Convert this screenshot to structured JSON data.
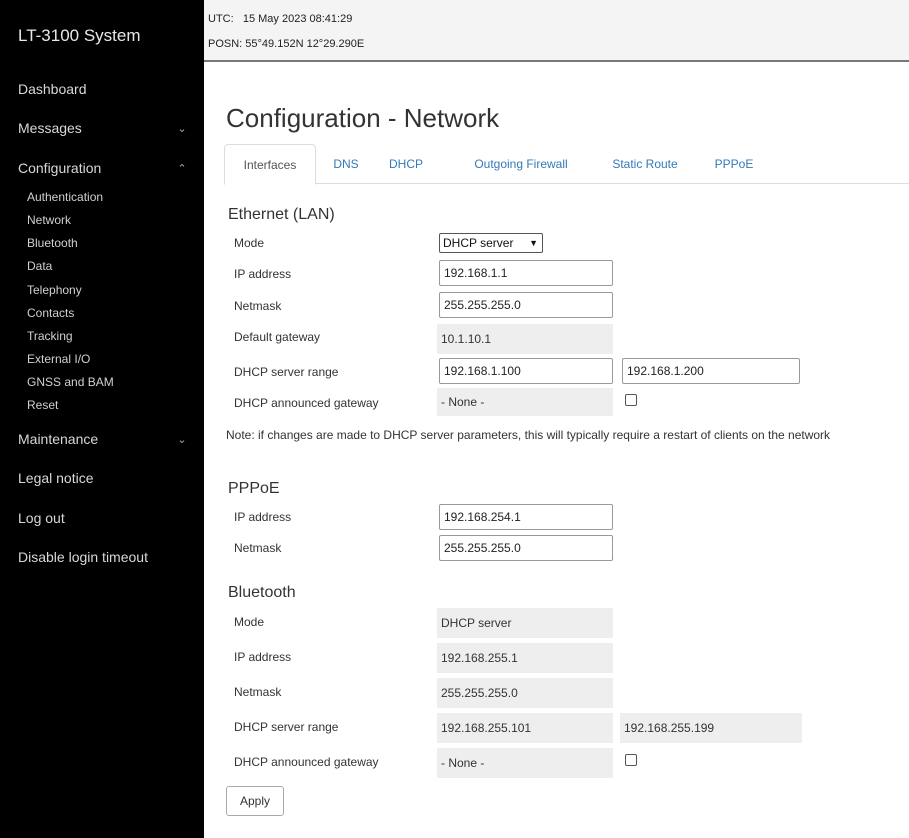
{
  "sidebar": {
    "brand": "LT-3100 System",
    "nav": [
      {
        "label": "Dashboard",
        "chevron": ""
      },
      {
        "label": "Messages",
        "chevron": "⌄"
      },
      {
        "label": "Configuration",
        "chevron": "⌃"
      },
      {
        "label": "Maintenance",
        "chevron": "⌄"
      },
      {
        "label": "Legal notice",
        "chevron": ""
      },
      {
        "label": "Log out",
        "chevron": ""
      },
      {
        "label": "Disable login timeout",
        "chevron": ""
      }
    ],
    "config_items": [
      "Authentication",
      "Network",
      "Bluetooth",
      "Data",
      "Telephony",
      "Contacts",
      "Tracking",
      "External I/O",
      "GNSS and BAM",
      "Reset"
    ]
  },
  "status": {
    "utc_label": "UTC:",
    "utc_value": "15 May 2023 08:41:29",
    "posn_label": "POSN:",
    "posn_value": "55°49.152N 12°29.290E"
  },
  "page_title": "Configuration - Network",
  "tabs": [
    "Interfaces",
    "DNS",
    "DHCP",
    "Outgoing Firewall",
    "Static Route",
    "PPPoE"
  ],
  "ethernet": {
    "title": "Ethernet (LAN)",
    "mode_label": "Mode",
    "mode_value": "DHCP server",
    "ip_label": "IP address",
    "ip_value": "192.168.1.1",
    "netmask_label": "Netmask",
    "netmask_value": "255.255.255.0",
    "gateway_label": "Default gateway",
    "gateway_value": "10.1.10.1",
    "range_label": "DHCP server range",
    "range_start": "192.168.1.100",
    "range_end": "192.168.1.200",
    "announced_label": "DHCP announced gateway",
    "announced_value": "- None -",
    "announced_checked": false
  },
  "note": "Note: if changes are made to DHCP server parameters, this will typically require a restart of clients on the network",
  "pppoe": {
    "title": "PPPoE",
    "ip_label": "IP address",
    "ip_value": "192.168.254.1",
    "netmask_label": "Netmask",
    "netmask_value": "255.255.255.0"
  },
  "bluetooth": {
    "title": "Bluetooth",
    "mode_label": "Mode",
    "mode_value": "DHCP server",
    "ip_label": "IP address",
    "ip_value": "192.168.255.1",
    "netmask_label": "Netmask",
    "netmask_value": "255.255.255.0",
    "range_label": "DHCP server range",
    "range_start": "192.168.255.101",
    "range_end": "192.168.255.199",
    "announced_label": "DHCP announced gateway",
    "announced_value": "- None -",
    "announced_checked": false
  },
  "apply_label": "Apply",
  "colors": {
    "sidebar_bg": "#000000",
    "link": "#337ab7",
    "readonly_bg": "#eeeeee"
  }
}
